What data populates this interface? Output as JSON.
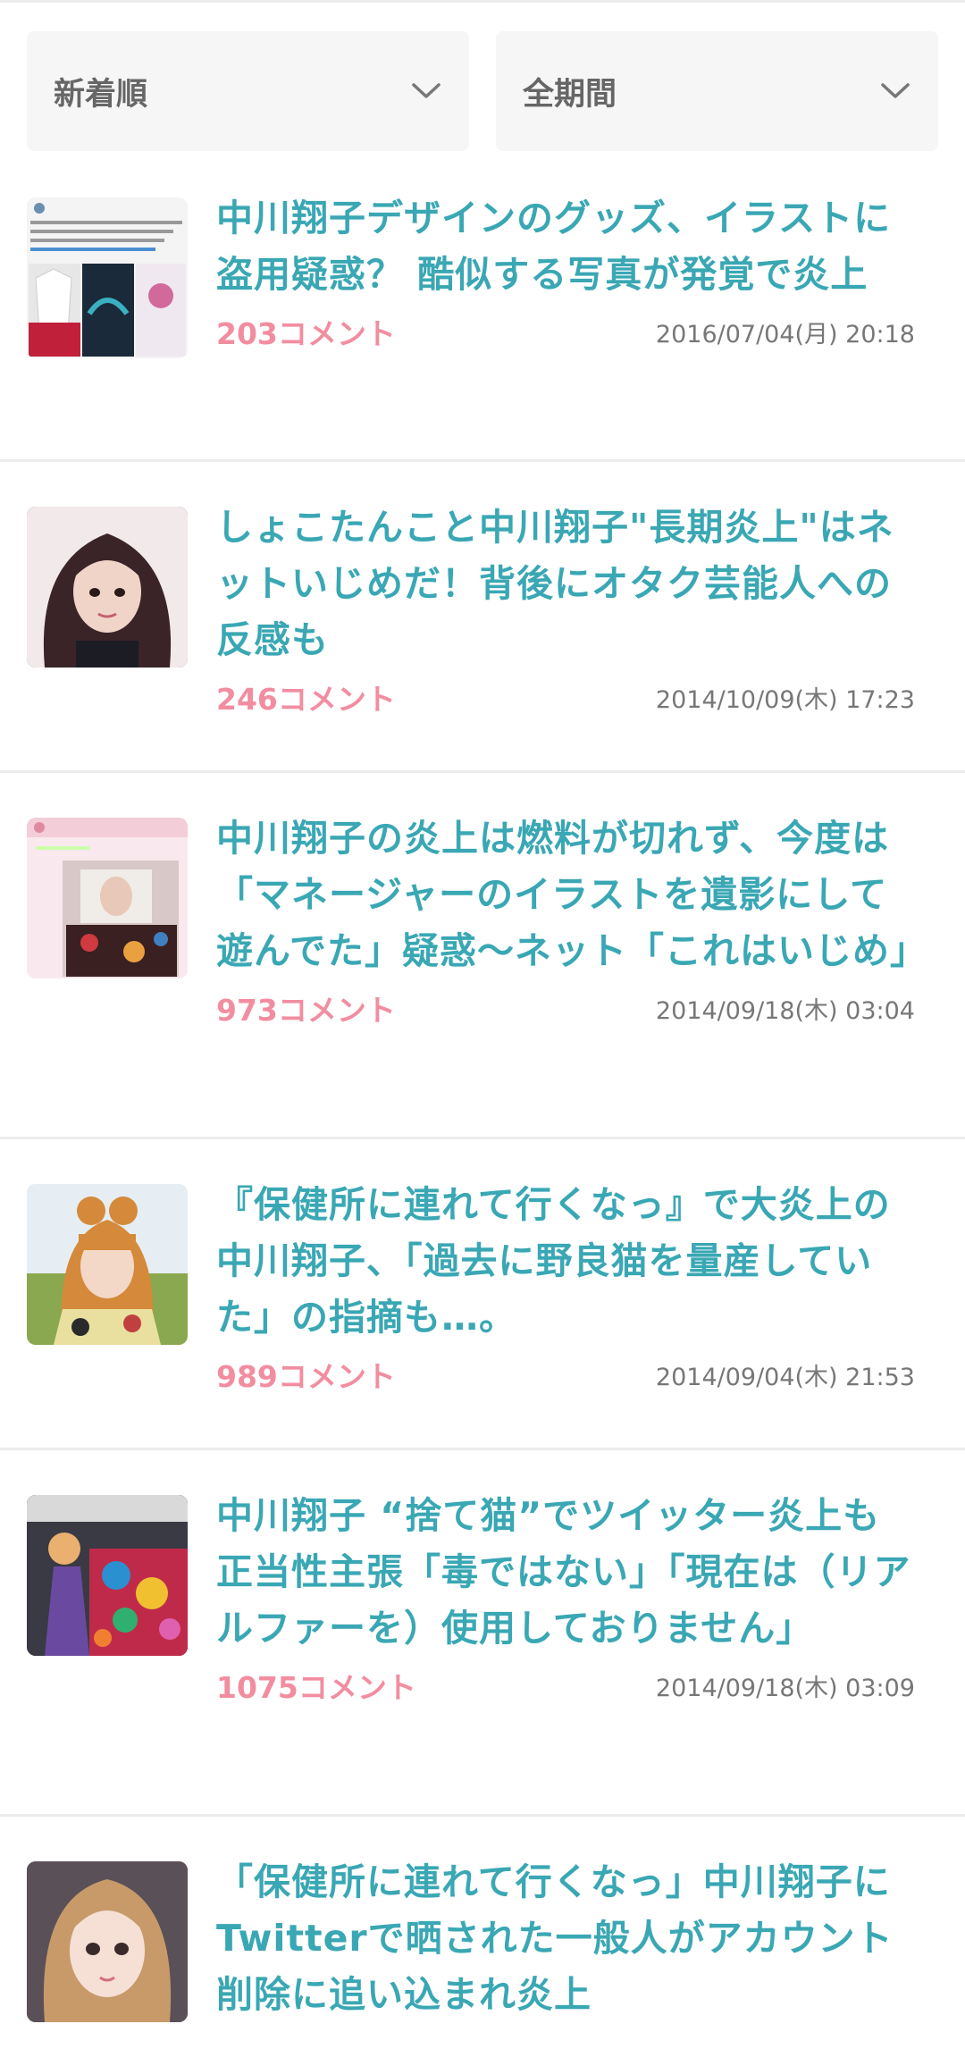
{
  "filters": {
    "sort_label": "新着順",
    "period_label": "全期間"
  },
  "colors": {
    "title": "#3aa7b4",
    "comments": "#f28da0",
    "date": "#777777",
    "filter_bg": "#f6f6f6"
  },
  "icons": {
    "dropdown": "chevron-down-icon"
  },
  "articles": [
    {
      "title": "中川翔子デザインのグッズ、イラストに盗用疑惑？ 酷似する写真が発覚で炎上",
      "comments": "203コメント",
      "date": "2016/07/04(月) 20:18"
    },
    {
      "title": "しょこたんこと中川翔子\"長期炎上\"はネットいじめだ！背後にオタク芸能人への反感も",
      "comments": "246コメント",
      "date": "2014/10/09(木) 17:23"
    },
    {
      "title": "中川翔子の炎上は燃料が切れず、今度は「マネージャーのイラストを遺影にして遊んでた」疑惑〜ネット「これはいじめ」",
      "comments": "973コメント",
      "date": "2014/09/18(木) 03:04"
    },
    {
      "title": "『保健所に連れて行くなっ』で大炎上の中川翔子、「過去に野良猫を量産していた」の指摘も…。",
      "comments": "989コメント",
      "date": "2014/09/04(木) 21:53"
    },
    {
      "title": "中川翔子 “捨て猫”でツイッター炎上も正当性主張「毒ではない」「現在は（リアルファーを）使用しておりません」",
      "comments": "1075コメント",
      "date": "2014/09/18(木) 03:09"
    },
    {
      "title": "「保健所に連れて行くなっ」中川翔子にTwitterで晒された一般人がアカウント削除に追い込まれ炎上",
      "comments": "",
      "date": ""
    }
  ]
}
